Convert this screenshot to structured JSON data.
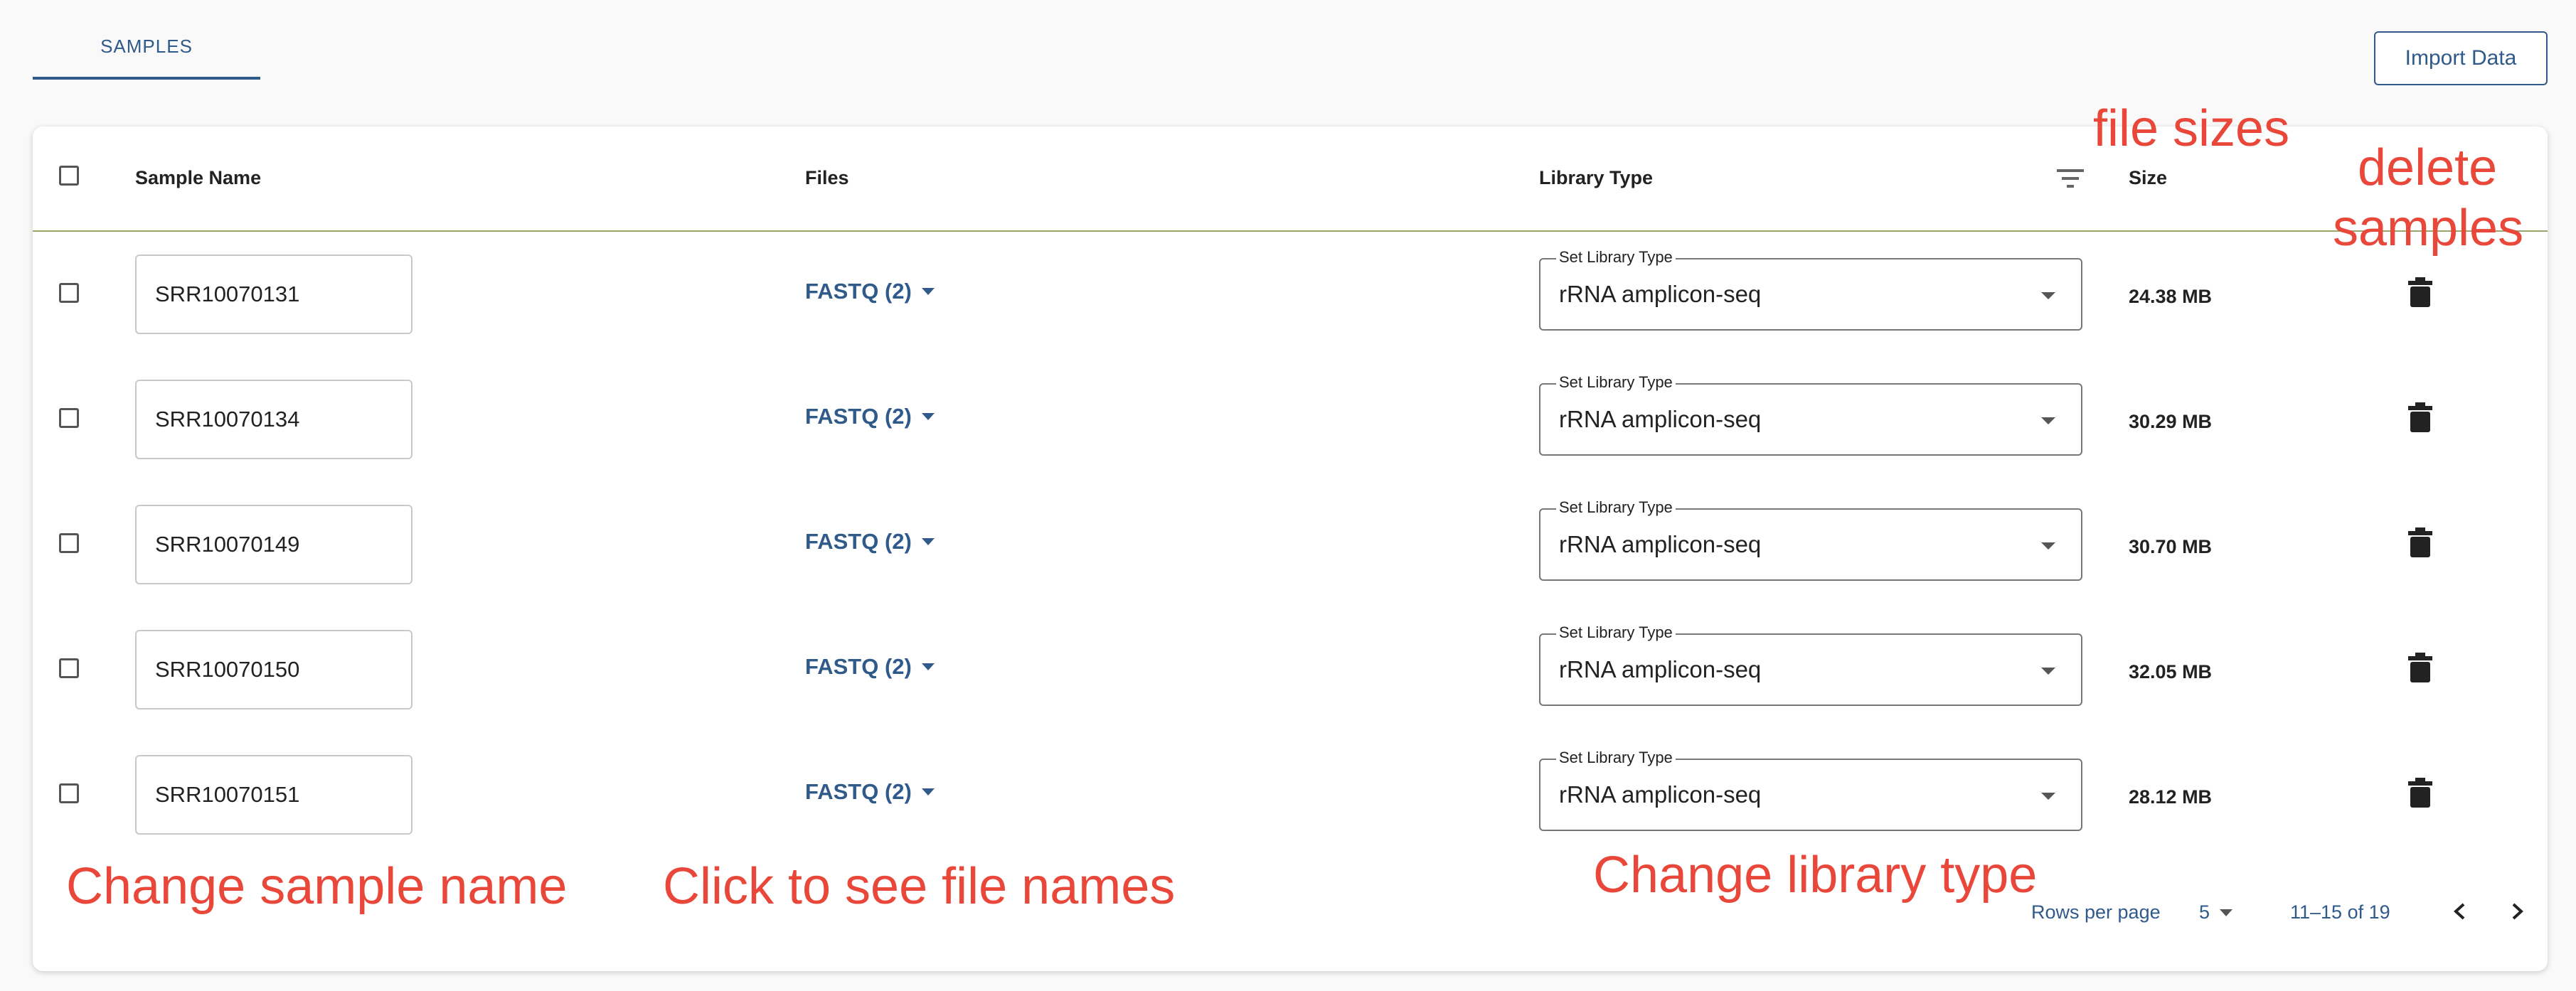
{
  "tabs": [
    {
      "label": "SAMPLES"
    }
  ],
  "import_button": "Import Data",
  "table": {
    "headers": {
      "sample_name": "Sample Name",
      "files": "Files",
      "library_type": "Library Type",
      "size": "Size"
    },
    "select_label": "Set Library Type",
    "rows": [
      {
        "name": "SRR10070131",
        "files": "FASTQ (2)",
        "library_type": "rRNA amplicon-seq",
        "size": "24.38 MB"
      },
      {
        "name": "SRR10070134",
        "files": "FASTQ (2)",
        "library_type": "rRNA amplicon-seq",
        "size": "30.29 MB"
      },
      {
        "name": "SRR10070149",
        "files": "FASTQ (2)",
        "library_type": "rRNA amplicon-seq",
        "size": "30.70 MB"
      },
      {
        "name": "SRR10070150",
        "files": "FASTQ (2)",
        "library_type": "rRNA amplicon-seq",
        "size": "32.05 MB"
      },
      {
        "name": "SRR10070151",
        "files": "FASTQ (2)",
        "library_type": "rRNA amplicon-seq",
        "size": "28.12 MB"
      }
    ]
  },
  "pagination": {
    "rows_per_page_label": "Rows per page",
    "rows_per_page": "5",
    "range": "11–15 of 19"
  },
  "annotations": {
    "file_sizes": "file sizes",
    "delete_line1": "delete",
    "delete_line2": "samples",
    "change_name": "Change sample name",
    "see_files": "Click to see file names",
    "change_library": "Change library type"
  },
  "colors": {
    "accent": "#2f5a8a",
    "annotation": "#e8473a",
    "header_divider": "#9aa66b"
  },
  "icons": [
    "filter-icon",
    "trash-icon",
    "chevron-left-icon",
    "chevron-right-icon",
    "caret-down-icon"
  ]
}
